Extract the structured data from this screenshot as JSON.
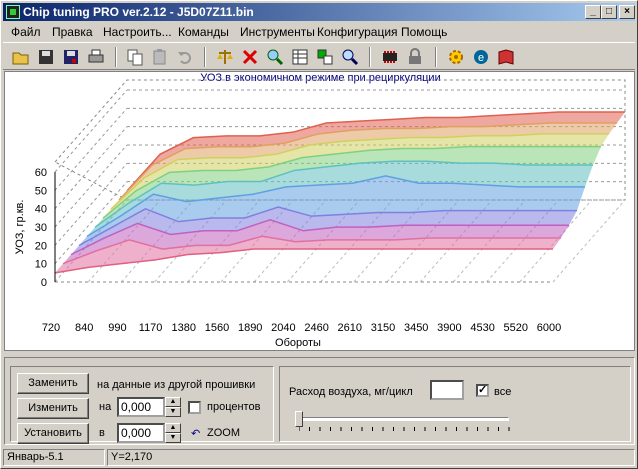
{
  "window": {
    "title": "Chip tuning PRO ver.2.12  -  J5D07Z11.bin",
    "min": "_",
    "max": "□",
    "close": "×"
  },
  "menu": [
    "Файл",
    "Правка",
    "Настроить...",
    "Команды",
    "Инструменты",
    "Конфигурация",
    "Помощь"
  ],
  "toolbar": [
    "open-icon",
    "save-icon",
    "save-as-icon",
    "print-icon",
    "copy-icon",
    "paste-icon",
    "undo-icon",
    "scales-icon",
    "delete-icon",
    "zoom-icon",
    "table-icon",
    "transfer-icon",
    "search-icon",
    "chip-icon",
    "lock-icon",
    "settings-icon",
    "help-icon",
    "book-icon"
  ],
  "chart_data": {
    "type": "area",
    "title": "УОЗ в экономичном режиме при рециркуляции",
    "xlabel": "Обороты",
    "ylabel": "УОЗ, гр.кв.",
    "ylim": [
      0,
      60
    ],
    "yticks": [
      "60",
      "50",
      "40",
      "30",
      "20",
      "10",
      "0"
    ],
    "categories": [
      "720",
      "840",
      "990",
      "1170",
      "1380",
      "1560",
      "1890",
      "2040",
      "2460",
      "2610",
      "3150",
      "3450",
      "3900",
      "4530",
      "5520",
      "6000"
    ],
    "grid": true,
    "series": [
      {
        "values": [
          5,
          8,
          10,
          12,
          15,
          16,
          18,
          18,
          18,
          18,
          18,
          18,
          18,
          18,
          18,
          18
        ]
      },
      {
        "values": [
          5,
          12,
          18,
          13,
          15,
          15,
          20,
          17,
          18,
          18,
          18,
          19,
          19,
          19,
          19,
          19
        ]
      },
      {
        "values": [
          5,
          14,
          22,
          16,
          18,
          18,
          24,
          18,
          20,
          20,
          21,
          21,
          21,
          21,
          21,
          21
        ]
      },
      {
        "values": [
          5,
          15,
          25,
          18,
          20,
          20,
          26,
          21,
          22,
          23,
          23,
          24,
          24,
          24,
          24,
          24
        ]
      },
      {
        "values": [
          5,
          16,
          28,
          24,
          26,
          28,
          32,
          33,
          34,
          38,
          34,
          34,
          33,
          32,
          32,
          32
        ]
      },
      {
        "values": [
          5,
          18,
          29,
          28,
          30,
          30,
          36,
          38,
          40,
          41,
          41,
          40,
          40,
          39,
          39,
          39
        ]
      },
      {
        "values": [
          5,
          20,
          30,
          31,
          31,
          33,
          38,
          40,
          42,
          43,
          43,
          44,
          44,
          44,
          44,
          44
        ]
      },
      {
        "values": [
          5,
          22,
          32,
          33,
          33,
          35,
          40,
          42,
          43,
          44,
          44,
          45,
          45,
          46,
          46,
          46
        ]
      },
      {
        "values": [
          5,
          24,
          33,
          34,
          34,
          36,
          41,
          43,
          44,
          44,
          45,
          45,
          46,
          47,
          47,
          47
        ]
      },
      {
        "values": [
          5,
          25,
          34,
          35,
          35,
          37,
          42,
          43,
          44,
          45,
          45,
          46,
          47,
          48,
          48,
          48
        ]
      }
    ]
  },
  "controls": {
    "replace": "Заменить",
    "change": "Изменить",
    "set": "Установить",
    "description": "на данные из другой прошивки",
    "on_label": "на",
    "in_label": "в",
    "value1": "0,000",
    "value2": "0,000",
    "percent": "процентов",
    "zoom": "ZOOM",
    "airflow": "Расход воздуха, мг/цикл",
    "all": "все"
  },
  "status": {
    "left": "Январь-5.1",
    "right": "Y=2,170"
  }
}
